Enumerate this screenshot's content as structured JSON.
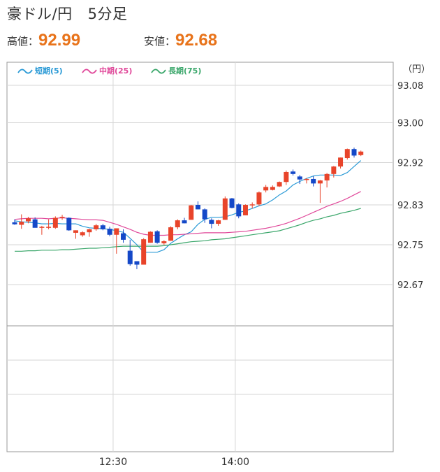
{
  "header": {
    "pair": "豪ドル/円",
    "timeframe": "5分足",
    "high_label": "高値：",
    "high_value": "92.99",
    "low_label": "安値：",
    "low_value": "92.68"
  },
  "chart_data": {
    "type": "candlestick",
    "unit": "（円）",
    "ylim": [
      92.58,
      93.07
    ],
    "yticks": [
      "93.08",
      "93.00",
      "92.92",
      "92.83",
      "92.75",
      "92.67"
    ],
    "ytick_values": [
      93.075,
      93.0,
      92.92,
      92.835,
      92.755,
      92.675
    ],
    "xticks": [
      {
        "label": "12:30",
        "index": 14.5
      },
      {
        "label": "14:00",
        "index": 32.5
      }
    ],
    "legend": [
      {
        "name": "短期(5)",
        "color": "#2a9ad6"
      },
      {
        "name": "中期(25)",
        "color": "#e0489a"
      },
      {
        "name": "長期(75)",
        "color": "#3ba76b"
      }
    ],
    "up_color": "#e8442a",
    "down_color": "#1448c8",
    "candles": [
      {
        "o": 92.8,
        "h": 92.806,
        "l": 92.795,
        "c": 92.796
      },
      {
        "o": 92.795,
        "h": 92.816,
        "l": 92.787,
        "c": 92.801
      },
      {
        "o": 92.802,
        "h": 92.811,
        "l": 92.798,
        "c": 92.808
      },
      {
        "o": 92.806,
        "h": 92.81,
        "l": 92.79,
        "c": 92.789
      },
      {
        "o": 92.789,
        "h": 92.793,
        "l": 92.775,
        "c": 92.791
      },
      {
        "o": 92.789,
        "h": 92.806,
        "l": 92.786,
        "c": 92.791
      },
      {
        "o": 92.789,
        "h": 92.812,
        "l": 92.787,
        "c": 92.809
      },
      {
        "o": 92.809,
        "h": 92.815,
        "l": 92.805,
        "c": 92.811
      },
      {
        "o": 92.809,
        "h": 92.81,
        "l": 92.783,
        "c": 92.784
      },
      {
        "o": 92.779,
        "h": 92.784,
        "l": 92.767,
        "c": 92.784
      },
      {
        "o": 92.774,
        "h": 92.782,
        "l": 92.771,
        "c": 92.78
      },
      {
        "o": 92.78,
        "h": 92.787,
        "l": 92.771,
        "c": 92.786
      },
      {
        "o": 92.786,
        "h": 92.797,
        "l": 92.783,
        "c": 92.794
      },
      {
        "o": 92.794,
        "h": 92.797,
        "l": 92.784,
        "c": 92.786
      },
      {
        "o": 92.787,
        "h": 92.791,
        "l": 92.772,
        "c": 92.775
      },
      {
        "o": 92.775,
        "h": 92.787,
        "l": 92.737,
        "c": 92.788
      },
      {
        "o": 92.778,
        "h": 92.786,
        "l": 92.759,
        "c": 92.765
      },
      {
        "o": 92.743,
        "h": 92.765,
        "l": 92.713,
        "c": 92.716
      },
      {
        "o": 92.722,
        "h": 92.722,
        "l": 92.706,
        "c": 92.715
      },
      {
        "o": 92.715,
        "h": 92.768,
        "l": 92.715,
        "c": 92.766
      },
      {
        "o": 92.759,
        "h": 92.782,
        "l": 92.759,
        "c": 92.781
      },
      {
        "o": 92.782,
        "h": 92.784,
        "l": 92.757,
        "c": 92.759
      },
      {
        "o": 92.758,
        "h": 92.764,
        "l": 92.755,
        "c": 92.762
      },
      {
        "o": 92.763,
        "h": 92.792,
        "l": 92.763,
        "c": 92.79
      },
      {
        "o": 92.79,
        "h": 92.806,
        "l": 92.786,
        "c": 92.804
      },
      {
        "o": 92.804,
        "h": 92.809,
        "l": 92.798,
        "c": 92.798
      },
      {
        "o": 92.805,
        "h": 92.835,
        "l": 92.805,
        "c": 92.834
      },
      {
        "o": 92.835,
        "h": 92.842,
        "l": 92.826,
        "c": 92.826
      },
      {
        "o": 92.826,
        "h": 92.828,
        "l": 92.799,
        "c": 92.806
      },
      {
        "o": 92.805,
        "h": 92.808,
        "l": 92.788,
        "c": 92.797
      },
      {
        "o": 92.797,
        "h": 92.805,
        "l": 92.793,
        "c": 92.804
      },
      {
        "o": 92.805,
        "h": 92.852,
        "l": 92.805,
        "c": 92.848
      },
      {
        "o": 92.848,
        "h": 92.849,
        "l": 92.828,
        "c": 92.829
      },
      {
        "o": 92.836,
        "h": 92.838,
        "l": 92.808,
        "c": 92.812
      },
      {
        "o": 92.814,
        "h": 92.836,
        "l": 92.814,
        "c": 92.835
      },
      {
        "o": 92.835,
        "h": 92.84,
        "l": 92.828,
        "c": 92.836
      },
      {
        "o": 92.836,
        "h": 92.862,
        "l": 92.833,
        "c": 92.86
      },
      {
        "o": 92.864,
        "h": 92.875,
        "l": 92.86,
        "c": 92.871
      },
      {
        "o": 92.865,
        "h": 92.874,
        "l": 92.864,
        "c": 92.871
      },
      {
        "o": 92.872,
        "h": 92.882,
        "l": 92.871,
        "c": 92.881
      },
      {
        "o": 92.881,
        "h": 92.904,
        "l": 92.875,
        "c": 92.901
      },
      {
        "o": 92.902,
        "h": 92.906,
        "l": 92.894,
        "c": 92.897
      },
      {
        "o": 92.892,
        "h": 92.895,
        "l": 92.877,
        "c": 92.886
      },
      {
        "o": 92.886,
        "h": 92.889,
        "l": 92.878,
        "c": 92.887
      },
      {
        "o": 92.887,
        "h": 92.893,
        "l": 92.872,
        "c": 92.878
      },
      {
        "o": 92.878,
        "h": 92.885,
        "l": 92.839,
        "c": 92.884
      },
      {
        "o": 92.884,
        "h": 92.899,
        "l": 92.87,
        "c": 92.897
      },
      {
        "o": 92.897,
        "h": 92.913,
        "l": 92.89,
        "c": 92.912
      },
      {
        "o": 92.912,
        "h": 92.93,
        "l": 92.908,
        "c": 92.93
      },
      {
        "o": 92.929,
        "h": 92.948,
        "l": 92.926,
        "c": 92.947
      },
      {
        "o": 92.947,
        "h": 92.95,
        "l": 92.93,
        "c": 92.934
      },
      {
        "o": 92.935,
        "h": 92.944,
        "l": 92.933,
        "c": 92.942
      }
    ],
    "series": [
      {
        "name": "短期(5)",
        "values": [
          92.803,
          92.801,
          92.8,
          92.799,
          92.797,
          92.797,
          92.798,
          92.797,
          92.797,
          92.797,
          92.792,
          92.789,
          92.788,
          92.787,
          92.786,
          92.783,
          92.78,
          92.768,
          92.755,
          92.74,
          92.74,
          92.74,
          92.745,
          92.758,
          92.767,
          92.775,
          92.781,
          92.796,
          92.806,
          92.81,
          92.81,
          92.811,
          92.815,
          92.82,
          92.823,
          92.828,
          92.833,
          92.837,
          92.845,
          92.855,
          92.863,
          92.875,
          92.882,
          92.888,
          92.893,
          92.895,
          92.895,
          92.895,
          92.894,
          92.9,
          92.912,
          92.924
        ]
      },
      {
        "name": "中期(25)",
        "values": [
          92.806,
          92.807,
          92.808,
          92.808,
          92.808,
          92.807,
          92.808,
          92.809,
          92.808,
          92.807,
          92.806,
          92.805,
          92.805,
          92.804,
          92.8,
          92.796,
          92.791,
          92.786,
          92.78,
          92.776,
          92.774,
          92.774,
          92.774,
          92.775,
          92.775,
          92.776,
          92.777,
          92.778,
          92.779,
          92.779,
          92.779,
          92.779,
          92.78,
          92.781,
          92.782,
          92.784,
          92.786,
          92.788,
          92.791,
          92.794,
          92.798,
          92.803,
          92.808,
          92.814,
          92.82,
          92.826,
          92.832,
          92.837,
          92.842,
          92.848,
          92.855,
          92.862
        ]
      },
      {
        "name": "長期(75)",
        "values": [
          92.742,
          92.742,
          92.743,
          92.743,
          92.744,
          92.744,
          92.744,
          92.745,
          92.745,
          92.746,
          92.747,
          92.748,
          92.748,
          92.749,
          92.75,
          92.751,
          92.752,
          92.752,
          92.752,
          92.752,
          92.752,
          92.752,
          92.753,
          92.755,
          92.757,
          92.759,
          92.761,
          92.762,
          92.763,
          92.765,
          92.766,
          92.767,
          92.769,
          92.771,
          92.773,
          92.775,
          92.777,
          92.779,
          92.781,
          92.783,
          92.787,
          92.791,
          92.795,
          92.8,
          92.804,
          92.807,
          92.811,
          92.814,
          92.818,
          92.821,
          92.824,
          92.828
        ]
      }
    ]
  }
}
